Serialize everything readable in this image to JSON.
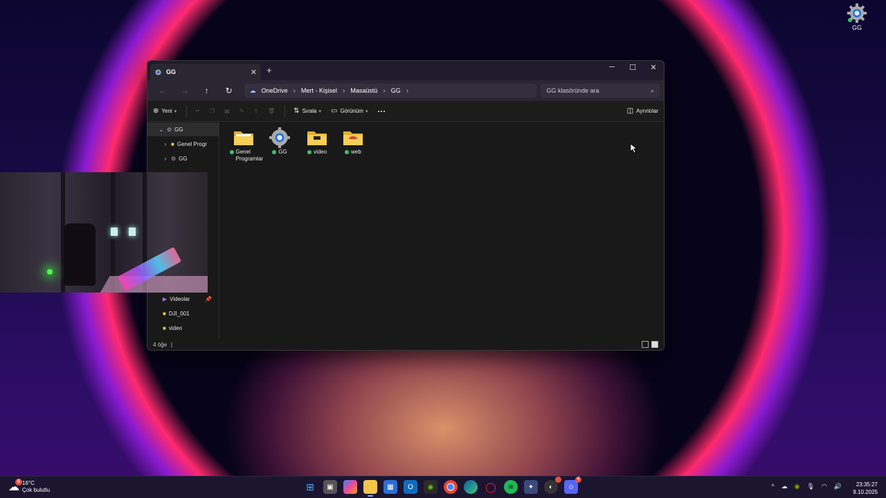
{
  "desktop": {
    "icon_label": "GG"
  },
  "window": {
    "tab_title": "GG",
    "new_tab": "+",
    "controls": {
      "minimize": "─",
      "maximize": "☐",
      "close": "✕"
    },
    "breadcrumb": [
      "OneDrive",
      "Mert - Kişisel",
      "Masaüstü",
      "GG"
    ],
    "search_placeholder": "GG klasöründe ara",
    "toolbar": {
      "new_label": "Yeni",
      "sort_label": "Sırala",
      "view_label": "Görünüm",
      "more": "···",
      "details_label": "Ayrıntılar"
    },
    "sidebar": {
      "items": [
        {
          "label": "GG",
          "expanded": true,
          "icon": "gear-icon"
        },
        {
          "label": "Genel Progr",
          "icon": "folder-icon"
        },
        {
          "label": "GG",
          "icon": "gear-icon"
        },
        {
          "label": "Videolar",
          "icon": "videos-icon",
          "pinned": true
        },
        {
          "label": "DJI_001",
          "icon": "folder-icon"
        },
        {
          "label": "video",
          "icon": "folder-icon"
        }
      ]
    },
    "files": [
      {
        "name": "Genel Programlar",
        "icon": "folder-docs-icon"
      },
      {
        "name": "GG",
        "icon": "gear-icon"
      },
      {
        "name": "video",
        "icon": "folder-video-icon"
      },
      {
        "name": "web",
        "icon": "folder-web-icon"
      }
    ],
    "status": {
      "count": "4 öğe",
      "sep": "|"
    }
  },
  "taskbar": {
    "weather": {
      "temp": "16°C",
      "desc": "Çok bulutlu",
      "badge": "6"
    },
    "discord_badge": "6",
    "clock": {
      "time": "23:35:27",
      "date": "9.10.2025"
    }
  },
  "colors": {
    "accent": "#8ab4ff",
    "sync_ok": "#3cc26a",
    "folder": "#f3c64a"
  }
}
